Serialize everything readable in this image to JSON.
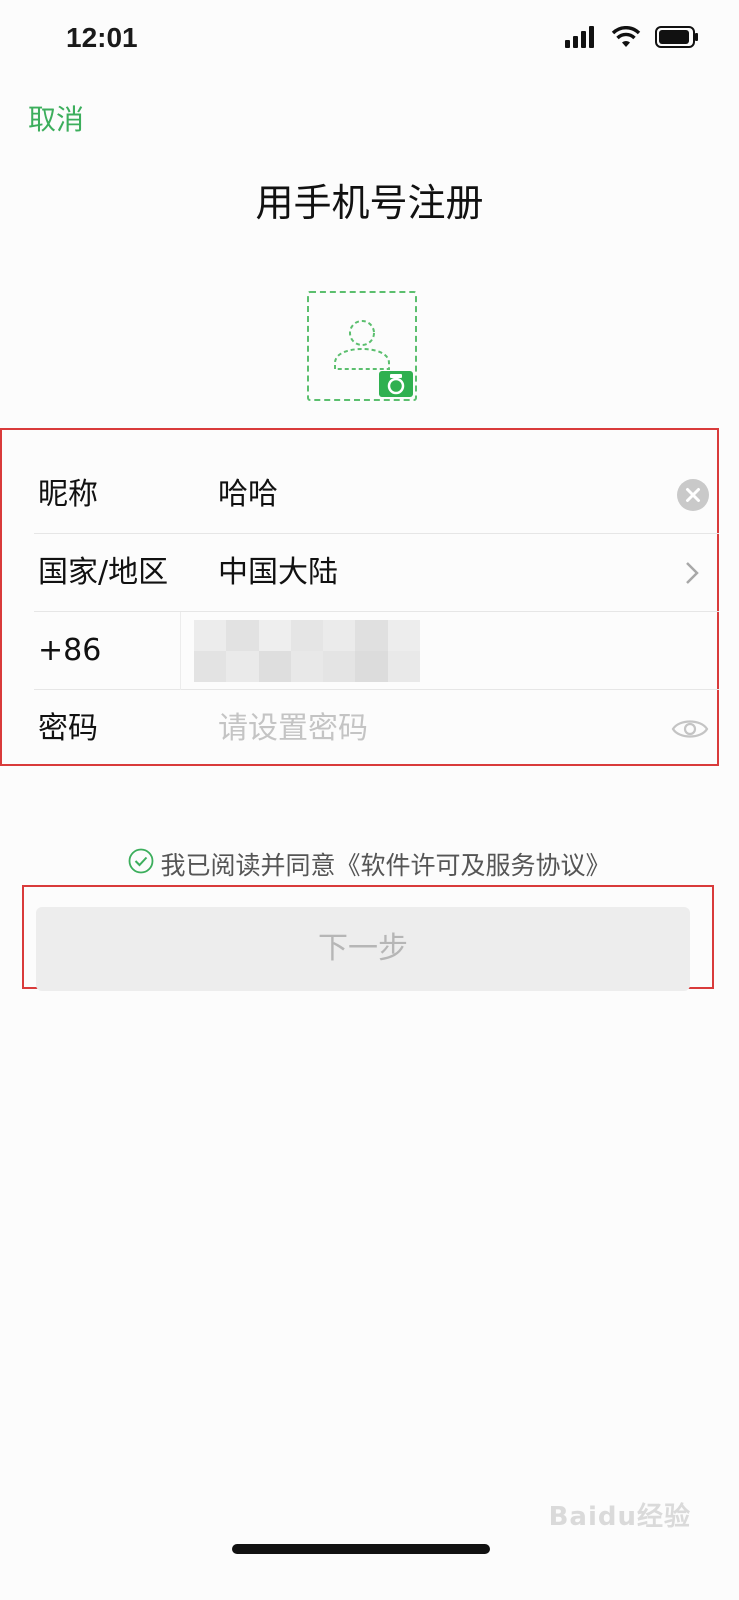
{
  "status_bar": {
    "time": "12:01",
    "icons": [
      "cellular-signal-icon",
      "wifi-icon",
      "battery-icon"
    ]
  },
  "header": {
    "cancel_label": "取消",
    "title": "用手机号注册"
  },
  "avatar": {
    "icon": "person-placeholder-icon",
    "badge_icon": "camera-icon"
  },
  "form": {
    "nickname_label": "昵称",
    "nickname_value": "哈哈",
    "region_label": "国家/地区",
    "region_value": "中国大陆",
    "phone_code": "+86",
    "password_label": "密码",
    "password_placeholder": "请设置密码"
  },
  "agreement": {
    "text": "我已阅读并同意《软件许可及服务协议》"
  },
  "next_button": {
    "label": "下一步"
  },
  "watermark": {
    "text": "Baidu经验"
  },
  "colors": {
    "accent": "#3cae5c",
    "highlight_border": "#d93b3b",
    "button_bg": "#ededed",
    "button_text": "#b6b6b6"
  }
}
